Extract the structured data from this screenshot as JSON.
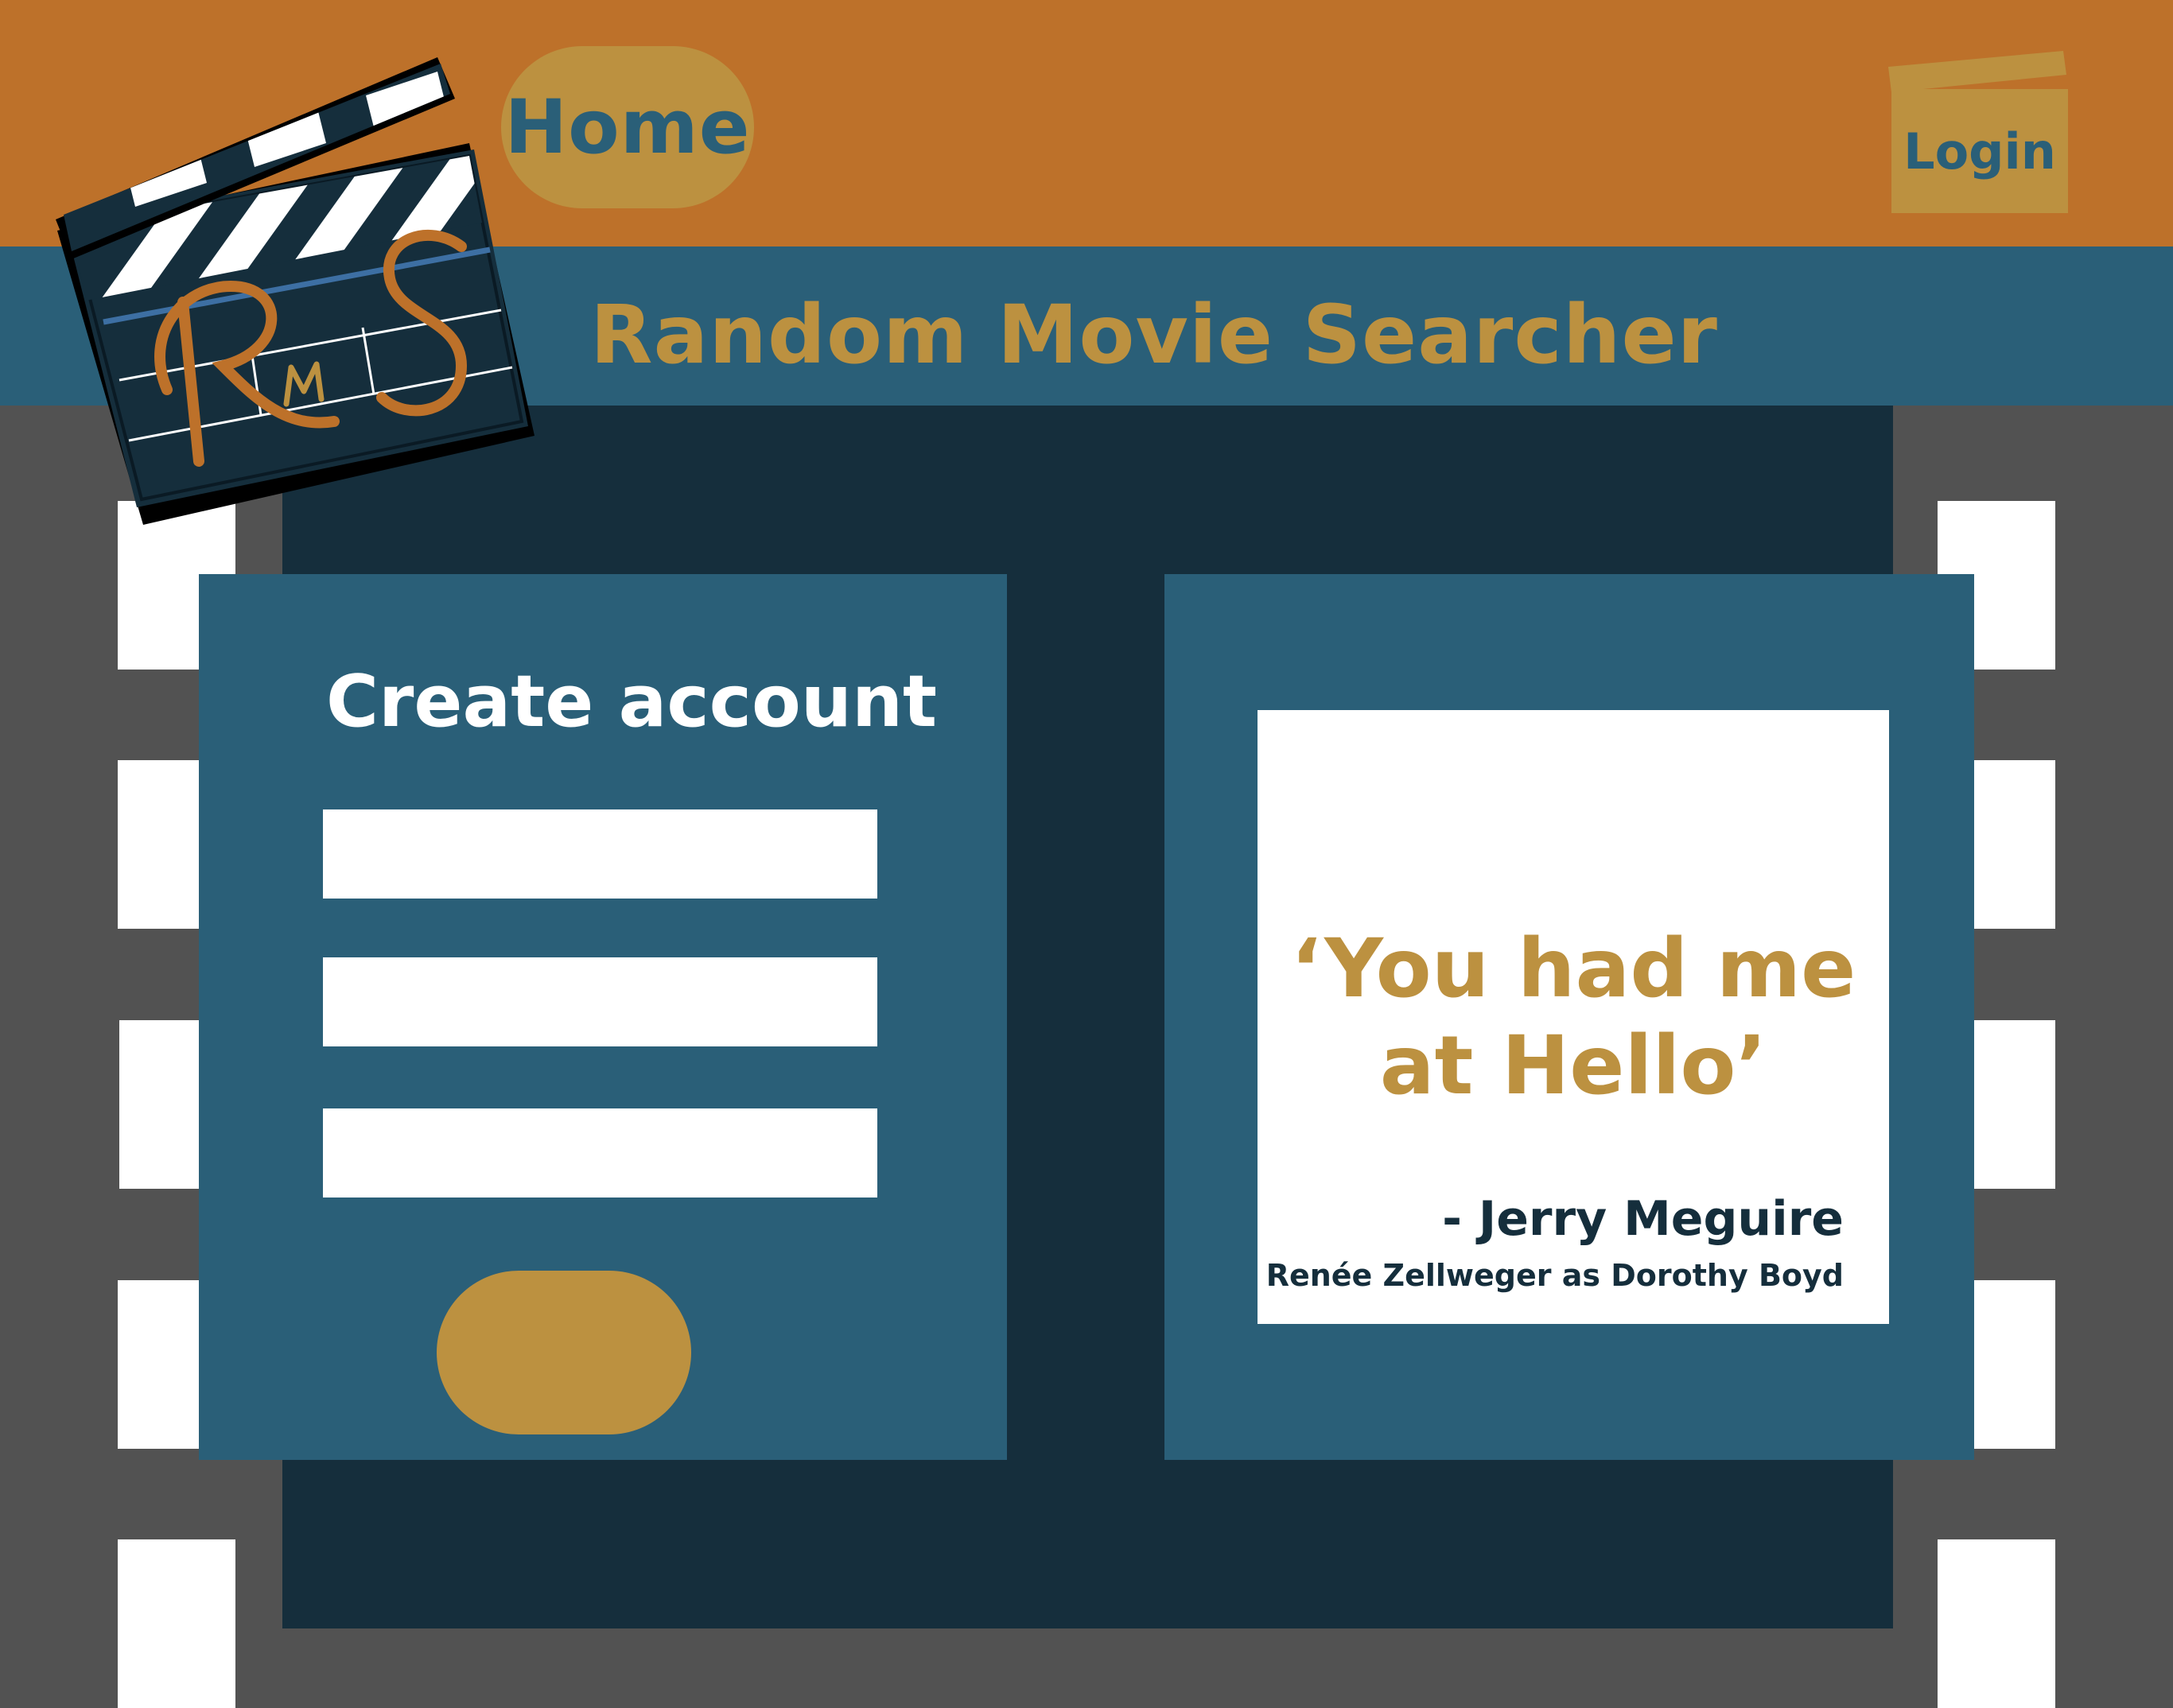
{
  "header": {
    "home_label": "Home",
    "login_label": "Login",
    "site_title": "Random Movie Searcher"
  },
  "logo": {
    "text": "RMS",
    "icon": "clapperboard-icon"
  },
  "create_account": {
    "title": "Create account",
    "fields": [
      {
        "value": "",
        "placeholder": ""
      },
      {
        "value": "",
        "placeholder": ""
      },
      {
        "value": "",
        "placeholder": ""
      }
    ],
    "submit_label": ""
  },
  "quote": {
    "line1": "‘You had me",
    "line2": "at Hello’",
    "movie": "- Jerry Meguire",
    "credit": "Renée Zellweger as Dorothy Boyd"
  },
  "colors": {
    "header_orange": "#bd712a",
    "title_blue": "#2a5f78",
    "gold": "#bc9140",
    "dark_navy": "#152e3c",
    "film_gray": "#525252",
    "white": "#ffffff"
  }
}
